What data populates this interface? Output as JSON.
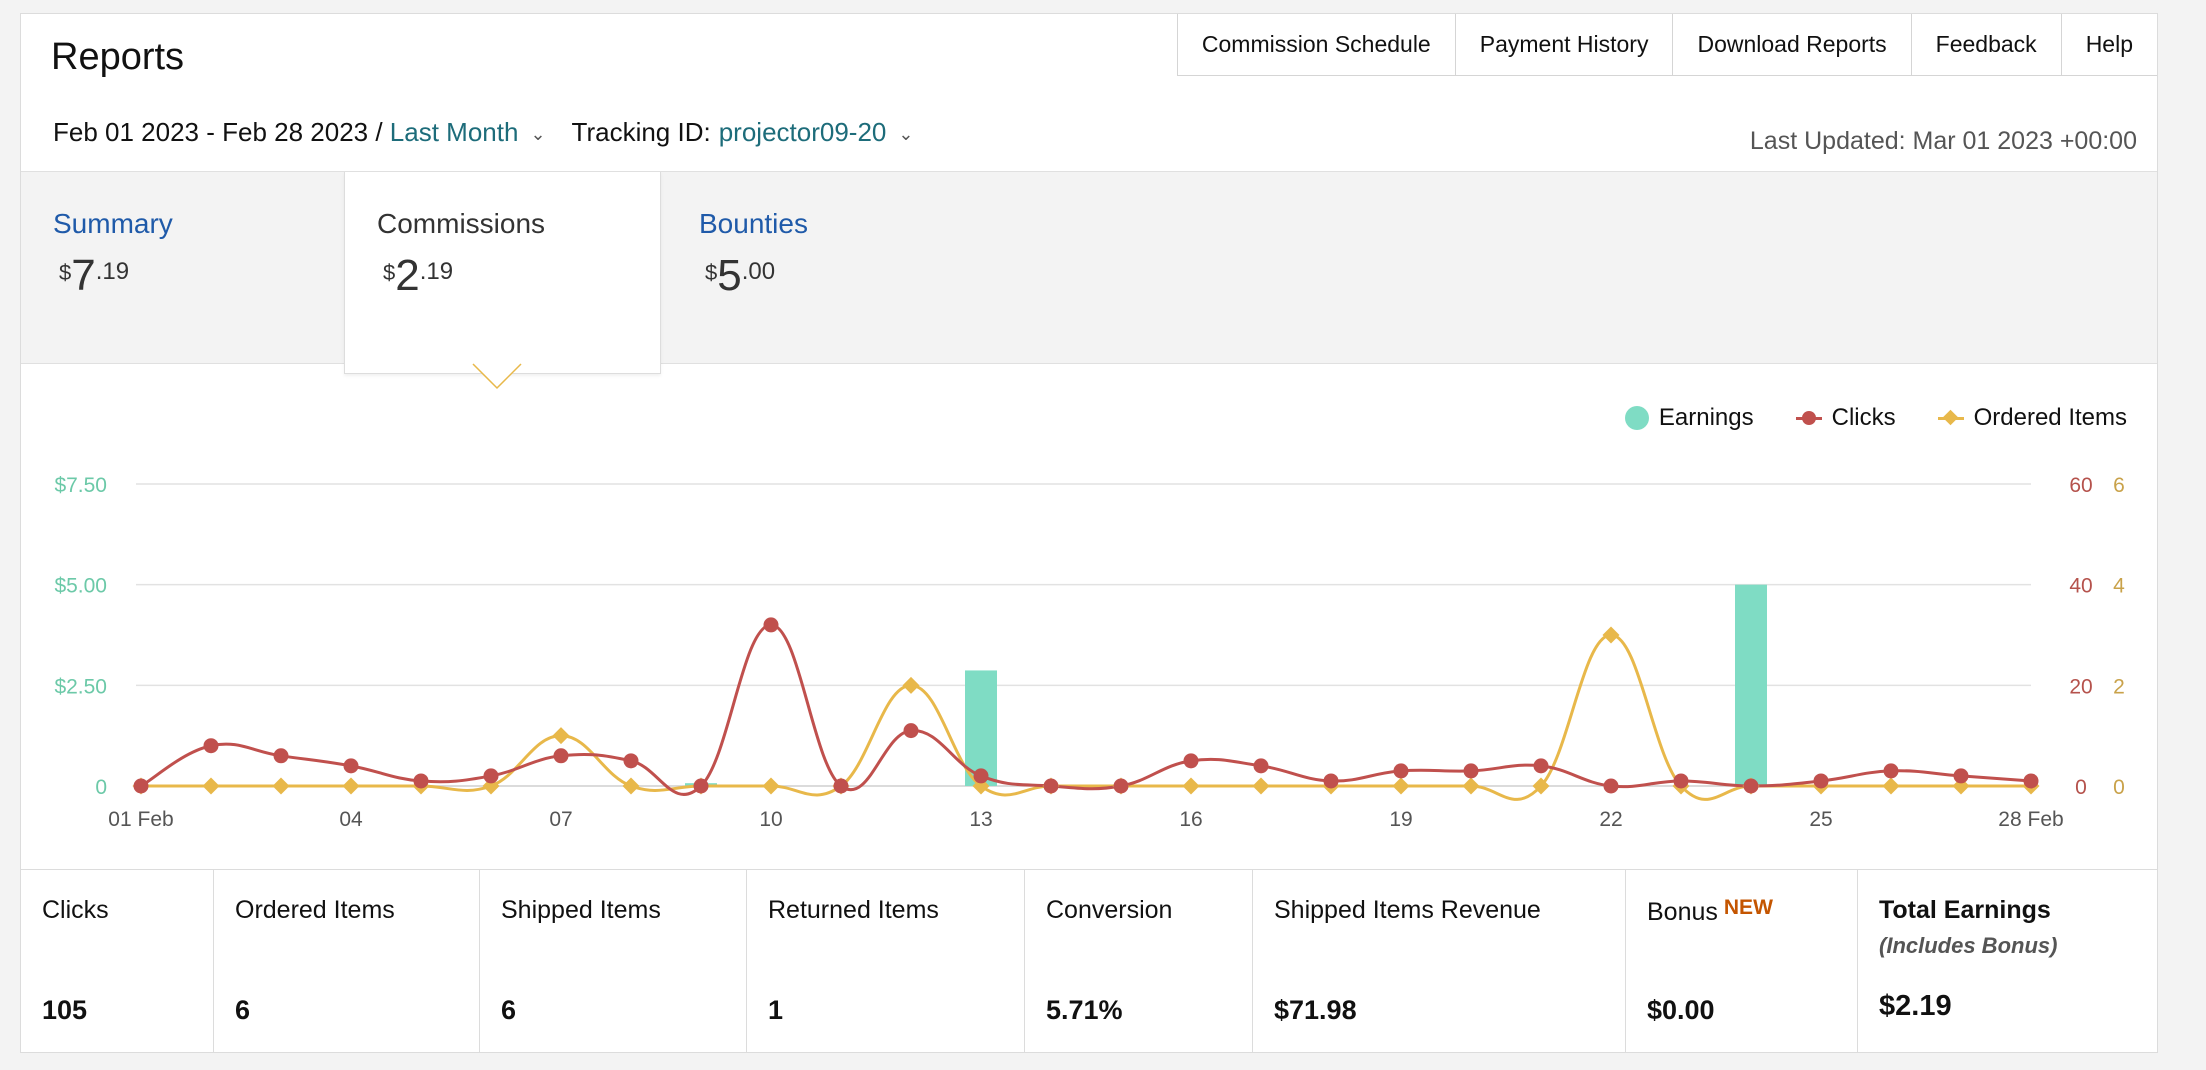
{
  "title": "Reports",
  "top_nav": [
    "Commission Schedule",
    "Payment History",
    "Download Reports",
    "Feedback",
    "Help"
  ],
  "filters": {
    "date_range": "Feb 01 2023 - Feb 28 2023",
    "separator": " / ",
    "preset": "Last Month",
    "tracking_label": "Tracking ID:",
    "tracking_id": "projector09-20"
  },
  "last_updated": "Last Updated: Mar 01 2023 +00:00",
  "tabs": {
    "summary": {
      "label": "Summary",
      "currency": "$",
      "whole": "7",
      "cents": ".19"
    },
    "commissions": {
      "label": "Commissions",
      "currency": "$",
      "whole": "2",
      "cents": ".19"
    },
    "bounties": {
      "label": "Bounties",
      "currency": "$",
      "whole": "5",
      "cents": ".00"
    }
  },
  "legend": {
    "earnings": "Earnings",
    "clicks": "Clicks",
    "ordered": "Ordered Items"
  },
  "colors": {
    "earnings": "#7fdcc4",
    "clicks": "#c0504d",
    "ordered": "#e8b84a",
    "earnings_axis": "#6cc9a8",
    "clicks_axis": "#b5524c",
    "ordered_axis": "#c9a24a",
    "grid": "#e2e2e2"
  },
  "chart_data": {
    "type": "bar+line",
    "x": [
      "01",
      "02",
      "03",
      "04",
      "05",
      "06",
      "07",
      "08",
      "09",
      "10",
      "11",
      "12",
      "13",
      "14",
      "15",
      "16",
      "17",
      "18",
      "19",
      "20",
      "21",
      "22",
      "23",
      "24",
      "25",
      "26",
      "27",
      "28"
    ],
    "x_tick_labels": [
      {
        "day": 1,
        "label": "01 Feb"
      },
      {
        "day": 4,
        "label": "04"
      },
      {
        "day": 7,
        "label": "07"
      },
      {
        "day": 10,
        "label": "10"
      },
      {
        "day": 13,
        "label": "13"
      },
      {
        "day": 16,
        "label": "16"
      },
      {
        "day": 19,
        "label": "19"
      },
      {
        "day": 22,
        "label": "22"
      },
      {
        "day": 25,
        "label": "25"
      },
      {
        "day": 28,
        "label": "28 Feb"
      }
    ],
    "series": [
      {
        "name": "Earnings",
        "kind": "bar",
        "axis": "left",
        "values": [
          0,
          0,
          0,
          0,
          0,
          0,
          0,
          0,
          0.07,
          0,
          0,
          0,
          2.87,
          0,
          0,
          0,
          0,
          0,
          0,
          0,
          0,
          0,
          0,
          5.0,
          0,
          0,
          0,
          0
        ]
      },
      {
        "name": "Clicks",
        "kind": "line",
        "axis": "right1",
        "values": [
          0,
          8,
          6,
          4,
          1,
          2,
          6,
          5,
          0,
          32,
          0,
          11,
          2,
          0,
          0,
          5,
          4,
          1,
          3,
          3,
          4,
          0,
          1,
          0,
          1,
          3,
          2,
          1
        ]
      },
      {
        "name": "Ordered Items",
        "kind": "line",
        "axis": "right2",
        "values": [
          0,
          0,
          0,
          0,
          0,
          0,
          1,
          0,
          0,
          0,
          0,
          2,
          0,
          0,
          0,
          0,
          0,
          0,
          0,
          0,
          0,
          3,
          0,
          0,
          0,
          0,
          0,
          0
        ]
      }
    ],
    "y_left": {
      "ticks": [
        "0",
        "$2.50",
        "$5.00",
        "$7.50"
      ],
      "lim": [
        0,
        7.5
      ]
    },
    "y_right1": {
      "ticks": [
        "0",
        "20",
        "40",
        "60"
      ],
      "lim": [
        0,
        60
      ]
    },
    "y_right2": {
      "ticks": [
        "0",
        "2",
        "4",
        "6"
      ],
      "lim": [
        0,
        6
      ]
    },
    "grid": true,
    "legend_position": "top-right"
  },
  "stats": [
    {
      "label": "Clicks",
      "value": "105"
    },
    {
      "label": "Ordered Items",
      "value": "6"
    },
    {
      "label": "Shipped Items",
      "value": "6"
    },
    {
      "label": "Returned Items",
      "value": "1"
    },
    {
      "label": "Conversion",
      "value": "5.71%"
    },
    {
      "label": "Shipped Items Revenue",
      "value": "$71.98"
    },
    {
      "label": "Bonus",
      "badge": "NEW",
      "value": "$0.00"
    },
    {
      "label": "Total Earnings",
      "sublabel": "(Includes Bonus)",
      "value": "$2.19"
    }
  ]
}
